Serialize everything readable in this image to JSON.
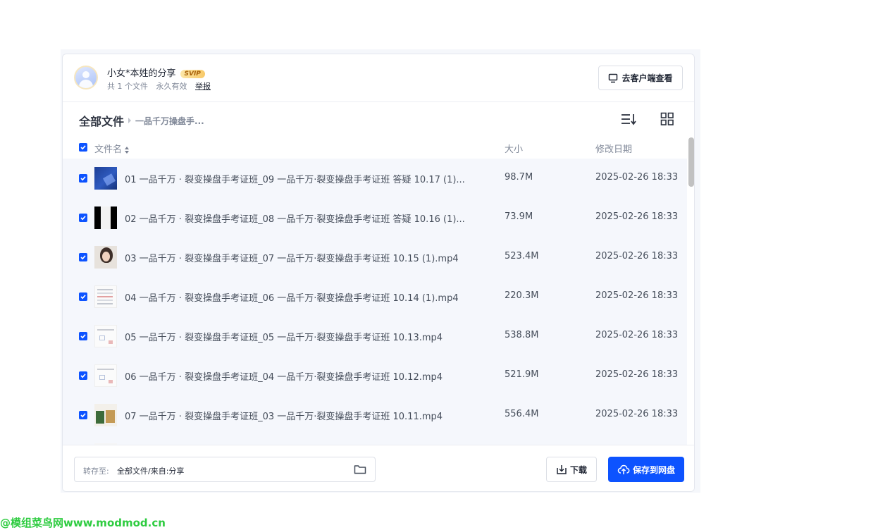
{
  "share": {
    "title": "小女*本姓的分享",
    "badge": "SVIP",
    "file_count": "共 1 个文件",
    "validity": "永久有效",
    "report": "举报",
    "client_button": "去客户端查看"
  },
  "breadcrumb": {
    "root": "全部文件",
    "current": "一品千万操盘手..."
  },
  "toolbar": {
    "sort_icon": "sort-list-icon",
    "grid_icon": "grid-view-icon"
  },
  "table": {
    "headers": {
      "name": "文件名",
      "size": "大小",
      "date": "修改日期"
    },
    "rows": [
      {
        "name": "01 一品千万 · 裂变操盘手考证班_09 一品千万·裂变操盘手考证班 答疑 10.17 (1)...",
        "size": "98.7M",
        "date": "2025-02-26 18:33",
        "thumb": "t-blue"
      },
      {
        "name": "02 一品千万 · 裂变操盘手考证班_08 一品千万·裂变操盘手考证班 答疑 10.16 (1)...",
        "size": "73.9M",
        "date": "2025-02-26 18:33",
        "thumb": "t-black"
      },
      {
        "name": "03 一品千万 · 裂变操盘手考证班_07 一品千万·裂变操盘手考证班 10.15 (1).mp4",
        "size": "523.4M",
        "date": "2025-02-26 18:33",
        "thumb": "t-face"
      },
      {
        "name": "04 一品千万 · 裂变操盘手考证班_06 一品千万·裂变操盘手考证班 10.14 (1).mp4",
        "size": "220.3M",
        "date": "2025-02-26 18:33",
        "thumb": "t-doc"
      },
      {
        "name": "05 一品千万 · 裂变操盘手考证班_05 一品千万·裂变操盘手考证班 10.13.mp4",
        "size": "538.8M",
        "date": "2025-02-26 18:33",
        "thumb": "t-flow"
      },
      {
        "name": "06 一品千万 · 裂变操盘手考证班_04 一品千万·裂变操盘手考证班 10.12.mp4",
        "size": "521.9M",
        "date": "2025-02-26 18:33",
        "thumb": "t-flow"
      },
      {
        "name": "07 一品千万 · 裂变操盘手考证班_03 一品千万·裂变操盘手考证班 10.11.mp4",
        "size": "556.4M",
        "date": "2025-02-26 18:33",
        "thumb": "t-mix"
      },
      {
        "name": "",
        "size": "",
        "date": "",
        "thumb": "t-part"
      }
    ]
  },
  "footer": {
    "save_to_label": "转存至:",
    "save_to_path": "全部文件/来自:分享",
    "download": "下载",
    "save": "保存到网盘"
  },
  "watermark": "@模组菜鸟网www.modmod.cn",
  "colors": {
    "accent": "#0d53ff",
    "watermark": "#2ecc40"
  }
}
